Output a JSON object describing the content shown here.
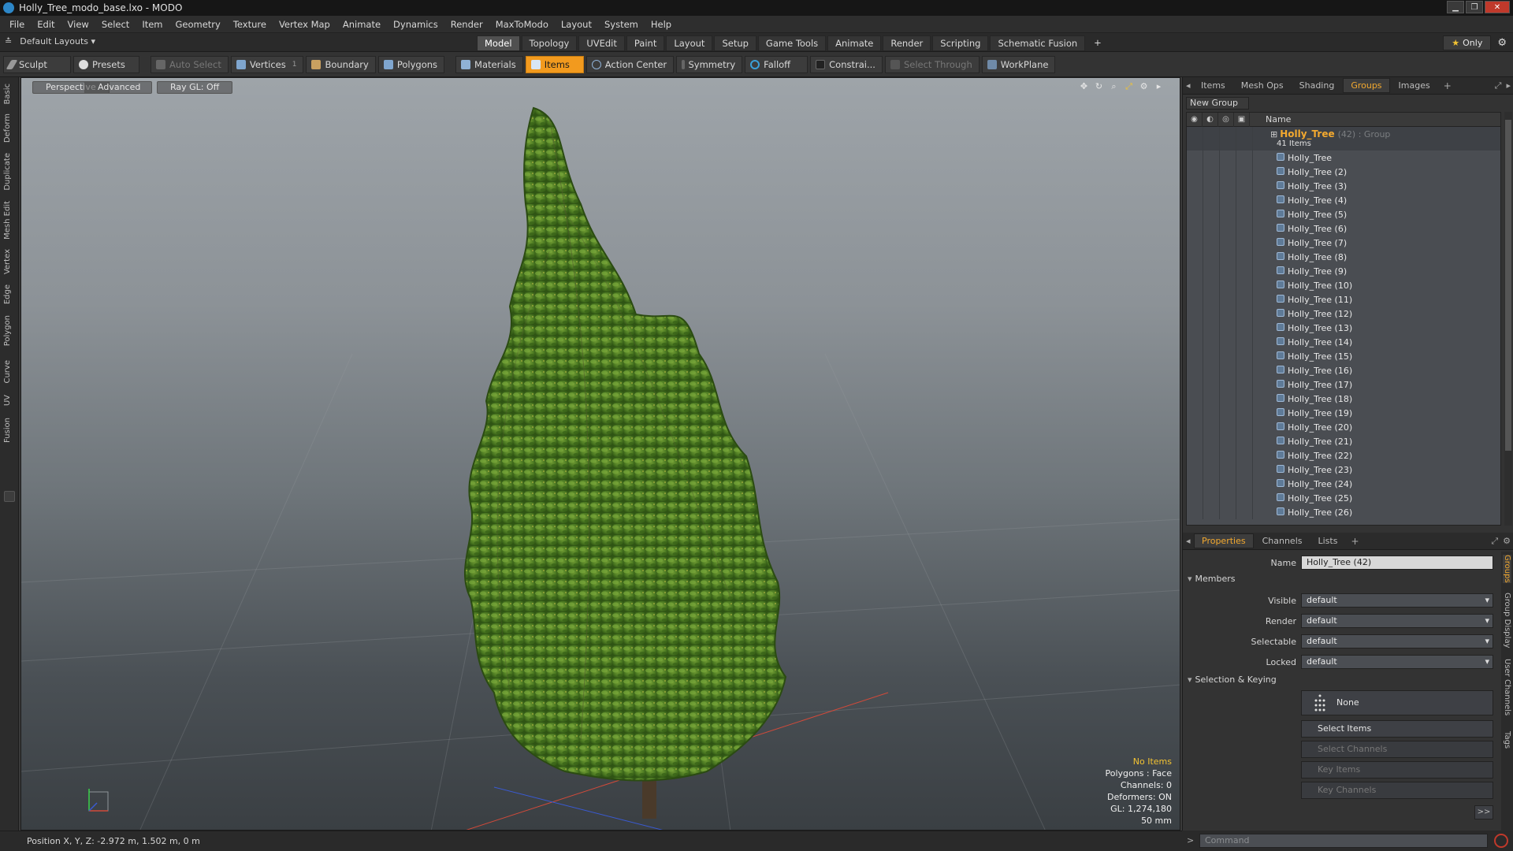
{
  "window": {
    "title": "Holly_Tree_modo_base.lxo - MODO"
  },
  "menu": [
    "File",
    "Edit",
    "View",
    "Select",
    "Item",
    "Geometry",
    "Texture",
    "Vertex Map",
    "Animate",
    "Dynamics",
    "Render",
    "MaxToModo",
    "Layout",
    "System",
    "Help"
  ],
  "layout": {
    "preset": "Default Layouts",
    "tabs": [
      "Model",
      "Topology",
      "UVEdit",
      "Paint",
      "Layout",
      "Setup",
      "Game Tools",
      "Animate",
      "Render",
      "Scripting",
      "Schematic Fusion"
    ],
    "active_tab": "Model",
    "only_label": "Only"
  },
  "toolbar": {
    "sculpt": "Sculpt",
    "presets": "Presets",
    "auto_select": "Auto Select",
    "vertices": "Vertices",
    "vertices_count": "1",
    "boundary": "Boundary",
    "polygons": "Polygons",
    "materials": "Materials",
    "items": "Items",
    "action_center": "Action Center",
    "symmetry": "Symmetry",
    "falloff": "Falloff",
    "constraints": "Constrai...",
    "select_through": "Select Through",
    "workplane": "WorkPlane"
  },
  "left_tabs": [
    "Basic",
    "Deform",
    "Duplicate",
    "Mesh Edit",
    "Vertex",
    "Edge",
    "Polygon",
    "Curve",
    "UV",
    "Fusion"
  ],
  "viewport": {
    "view": "Perspective",
    "mode": "Advanced",
    "raygl": "Ray GL: Off",
    "info": {
      "selection": "No Items",
      "polygons": "Polygons : Face",
      "channels": "Channels: 0",
      "deformers": "Deformers: ON",
      "gl": "GL: 1,274,180",
      "lens": "50 mm"
    }
  },
  "status": {
    "position": "Position X, Y, Z:  -2.972 m, 1.502 m, 0 m"
  },
  "groups_panel": {
    "tabs": [
      "Items",
      "Mesh Ops",
      "Shading",
      "Groups",
      "Images"
    ],
    "active_tab": "Groups",
    "new_group": "New Group",
    "column_name": "Name",
    "group": {
      "name": "Holly_Tree",
      "extra": "(42) : Group",
      "count": "41 Items"
    },
    "items": [
      "Holly_Tree",
      "Holly_Tree (2)",
      "Holly_Tree (3)",
      "Holly_Tree (4)",
      "Holly_Tree (5)",
      "Holly_Tree (6)",
      "Holly_Tree (7)",
      "Holly_Tree (8)",
      "Holly_Tree (9)",
      "Holly_Tree (10)",
      "Holly_Tree (11)",
      "Holly_Tree (12)",
      "Holly_Tree (13)",
      "Holly_Tree (14)",
      "Holly_Tree (15)",
      "Holly_Tree (16)",
      "Holly_Tree (17)",
      "Holly_Tree (18)",
      "Holly_Tree (19)",
      "Holly_Tree (20)",
      "Holly_Tree (21)",
      "Holly_Tree (22)",
      "Holly_Tree (23)",
      "Holly_Tree (24)",
      "Holly_Tree (25)",
      "Holly_Tree (26)"
    ]
  },
  "properties_panel": {
    "tabs": [
      "Properties",
      "Channels",
      "Lists"
    ],
    "active_tab": "Properties",
    "name_label": "Name",
    "name_value": "Holly_Tree (42)",
    "members_title": "Members",
    "visible_label": "Visible",
    "visible_value": "default",
    "render_label": "Render",
    "render_value": "default",
    "selectable_label": "Selectable",
    "selectable_value": "default",
    "locked_label": "Locked",
    "locked_value": "default",
    "selection_title": "Selection & Keying",
    "none_label": "None",
    "select_items": "Select Items",
    "select_channels": "Select Channels",
    "key_items": "Key Items",
    "key_channels": "Key Channels",
    "more": ">>",
    "side_tabs": [
      "Groups",
      "Group Display",
      "User Channels",
      "Tags"
    ]
  },
  "command": {
    "placeholder": "Command"
  },
  "colors": {
    "accent": "#f29a1e",
    "group_name": "#f3a92f"
  }
}
